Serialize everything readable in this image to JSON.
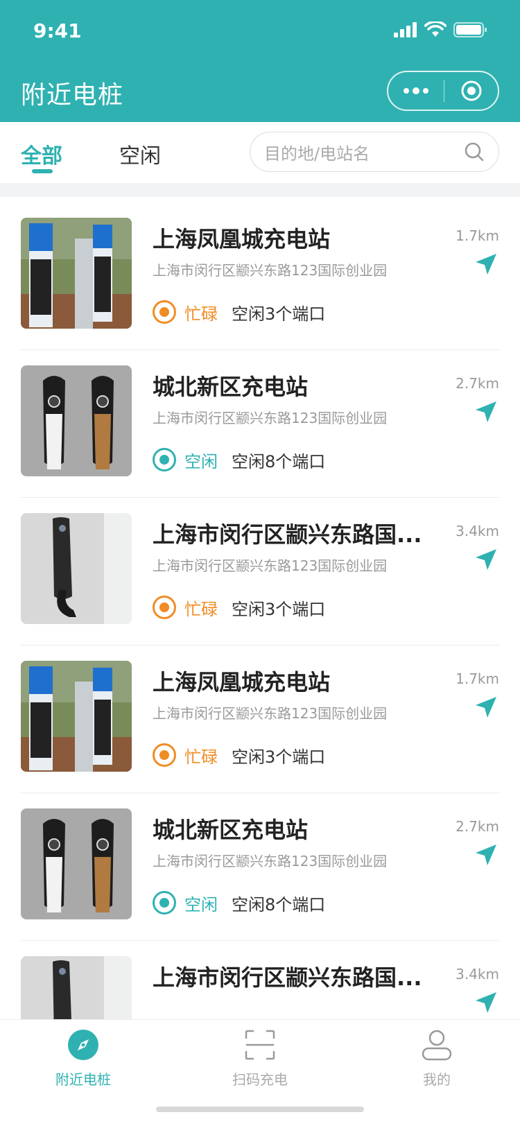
{
  "status_bar": {
    "time": "9:41"
  },
  "nav": {
    "title": "附近电桩"
  },
  "tabs": [
    {
      "label": "全部",
      "active": true
    },
    {
      "label": "空闲",
      "active": false
    }
  ],
  "search": {
    "placeholder": "目的地/电站名"
  },
  "colors": {
    "accent": "#2fb1b1",
    "busy": "#f08c24",
    "idle": "#2fb1b1"
  },
  "stations": [
    {
      "name": "上海凤凰城充电站",
      "address": "上海市闵行区颛兴东路123国际创业园",
      "distance": "1.7km",
      "status": "忙碌",
      "status_type": "busy",
      "ports": "空闲3个端口",
      "image": "ev-station-photo"
    },
    {
      "name": "城北新区充电站",
      "address": "上海市闵行区颛兴东路123国际创业园",
      "distance": "2.7km",
      "status": "空闲",
      "status_type": "idle",
      "ports": "空闲8个端口",
      "image": "charger-pair-photo"
    },
    {
      "name": "上海市闵行区颛兴东路国...",
      "address": "上海市闵行区颛兴东路123国际创业园",
      "distance": "3.4km",
      "status": "忙碌",
      "status_type": "busy",
      "ports": "空闲3个端口",
      "image": "wall-charger-photo"
    },
    {
      "name": "上海凤凰城充电站",
      "address": "上海市闵行区颛兴东路123国际创业园",
      "distance": "1.7km",
      "status": "忙碌",
      "status_type": "busy",
      "ports": "空闲3个端口",
      "image": "ev-station-photo"
    },
    {
      "name": "城北新区充电站",
      "address": "上海市闵行区颛兴东路123国际创业园",
      "distance": "2.7km",
      "status": "空闲",
      "status_type": "idle",
      "ports": "空闲8个端口",
      "image": "charger-pair-photo"
    },
    {
      "name": "上海市闵行区颛兴东路国...",
      "address": "",
      "distance": "3.4km",
      "status": "",
      "status_type": "busy",
      "ports": "",
      "image": "wall-charger-photo"
    }
  ],
  "tabbar": [
    {
      "label": "附近电桩",
      "icon": "compass-icon",
      "active": true
    },
    {
      "label": "扫码充电",
      "icon": "scan-icon",
      "active": false
    },
    {
      "label": "我的",
      "icon": "user-icon",
      "active": false
    }
  ]
}
